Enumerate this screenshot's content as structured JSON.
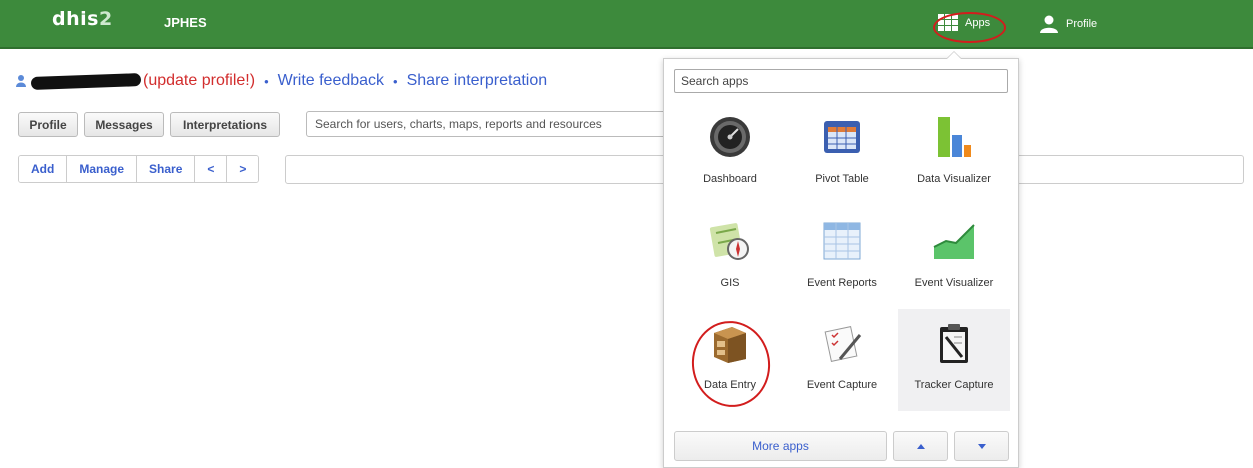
{
  "header": {
    "logo_main": "dhis",
    "logo_num": "2",
    "org": "JPHES",
    "apps_label": "Apps",
    "profile_label": "Profile",
    "apps_icon": "grid-icon",
    "profile_icon": "user-icon",
    "bg_color": "#3d8a3c"
  },
  "profile_line": {
    "update_text": "(update profile!)",
    "separator": "•",
    "write_feedback": "Write feedback",
    "share_interpretation": "Share interpretation"
  },
  "toolbar": {
    "profile": "Profile",
    "messages": "Messages",
    "interpretations": "Interpretations",
    "search_placeholder": "Search for users, charts, maps, reports and resources"
  },
  "nav": {
    "add": "Add",
    "manage": "Manage",
    "share": "Share",
    "prev": "<",
    "next": ">"
  },
  "apps_menu": {
    "search_placeholder": "Search apps",
    "apps": [
      {
        "label": "Dashboard",
        "icon": "dashboard-icon"
      },
      {
        "label": "Pivot Table",
        "icon": "pivot-table-icon"
      },
      {
        "label": "Data Visualizer",
        "icon": "bar-chart-icon"
      },
      {
        "label": "GIS",
        "icon": "map-compass-icon"
      },
      {
        "label": "Event Reports",
        "icon": "spreadsheet-icon"
      },
      {
        "label": "Event Visualizer",
        "icon": "area-chart-icon"
      },
      {
        "label": "Data Entry",
        "icon": "file-cabinet-icon"
      },
      {
        "label": "Event Capture",
        "icon": "paper-pen-icon"
      },
      {
        "label": "Tracker Capture",
        "icon": "clipboard-icon"
      }
    ],
    "more_apps": "More apps"
  },
  "annotation_color": "#d21d1d"
}
